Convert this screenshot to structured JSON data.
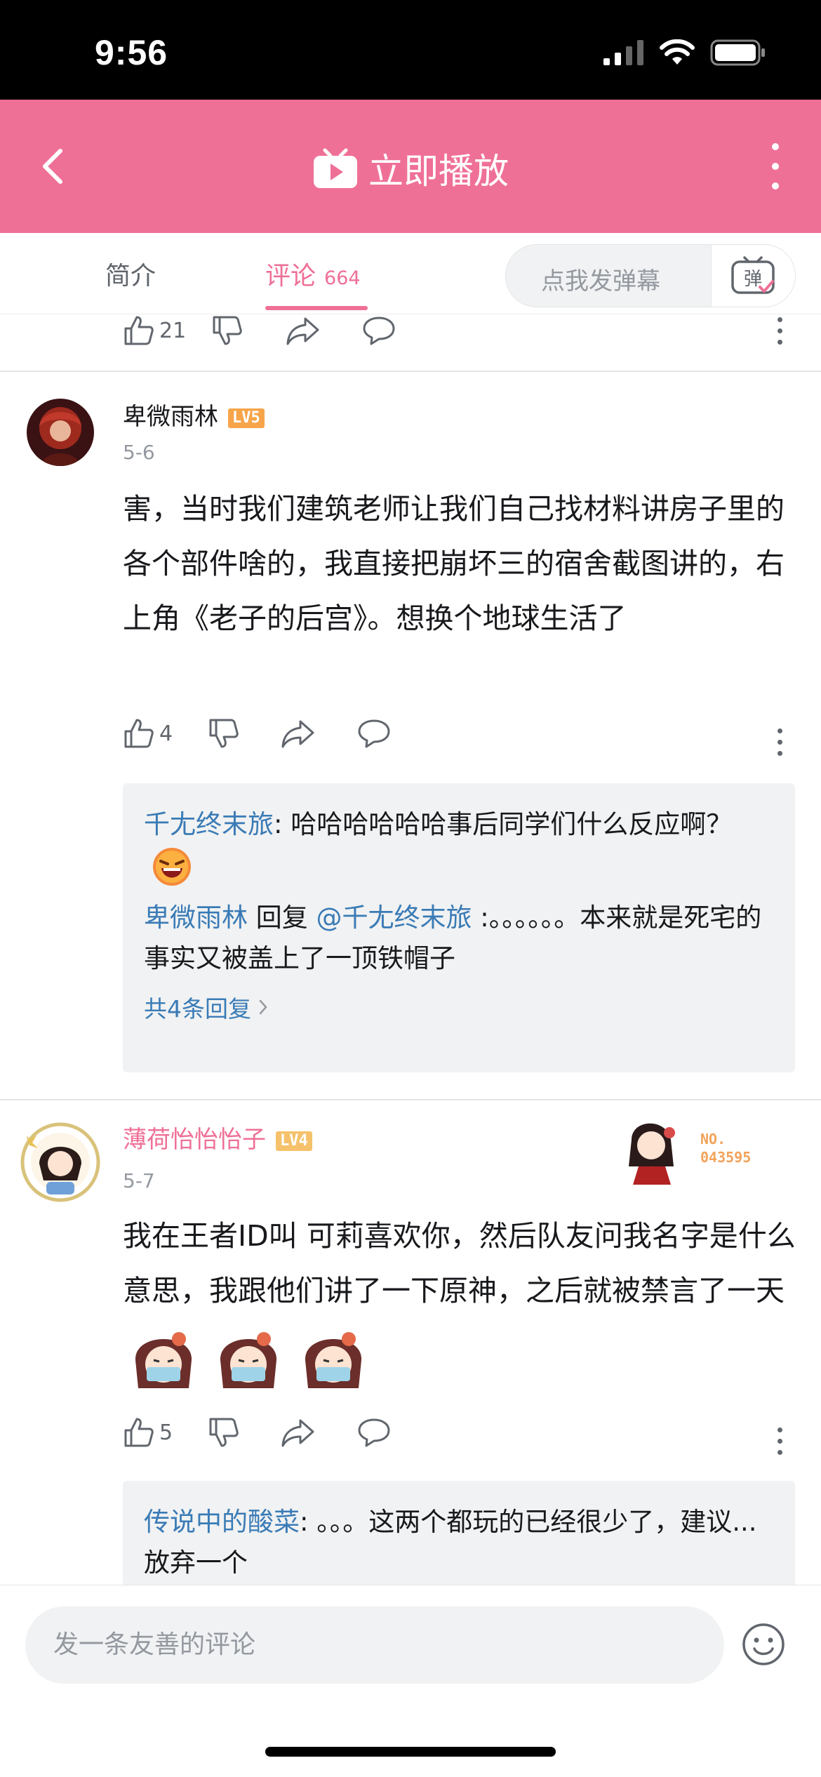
{
  "status_bar": {
    "time": "9:56"
  },
  "header": {
    "title": "立即播放"
  },
  "tabs": [
    {
      "label": "简介"
    },
    {
      "label": "评论",
      "count": "664"
    }
  ],
  "danmaku": {
    "placeholder": "点我发弹幕",
    "button_label": "弹"
  },
  "top_action_bar": {
    "like_count": "21"
  },
  "comments": [
    {
      "username": "卑微雨林",
      "level": "LV5",
      "date": "5-6",
      "text": "害，当时我们建筑老师让我们自己找材料讲房子里的各个部件啥的，我直接把崩坏三的宿舍截图讲的，右上角《老子的后宫》。想换个地球生活了",
      "like_count": "4",
      "replies": [
        {
          "name": "千尢终末旅",
          "text": ": 哈哈哈哈哈哈事后同学们什么反应啊？"
        },
        {
          "name": "卑微雨林",
          "reply_word": " 回复 ",
          "target": "@千尢终末旅",
          "text": " :。。。。。。本来就是死宅的事实又被盖上了一顶铁帽子"
        }
      ],
      "reply_count_label": "共4条回复"
    },
    {
      "username": "薄荷怡怡怡子",
      "level": "LV4",
      "date": "5-7",
      "badge_no": "NO.",
      "badge_number": "043595",
      "text": "我在王者ID叫 可莉喜欢你，然后队友问我名字是什么意思，我跟他们讲了一下原神，之后就被禁言了一天",
      "like_count": "5",
      "replies": [
        {
          "name": "传说中的酸菜",
          "text": ": 。。。这两个都玩的已经很少了，建议...放弃一个"
        }
      ]
    }
  ],
  "comment_input": {
    "placeholder": "发一条友善的评论"
  },
  "colors": {
    "brand_pink": "#ef7097",
    "link_blue": "#3a7bb6",
    "lv5": "#f7a54a",
    "lv4": "#f5c26b"
  }
}
